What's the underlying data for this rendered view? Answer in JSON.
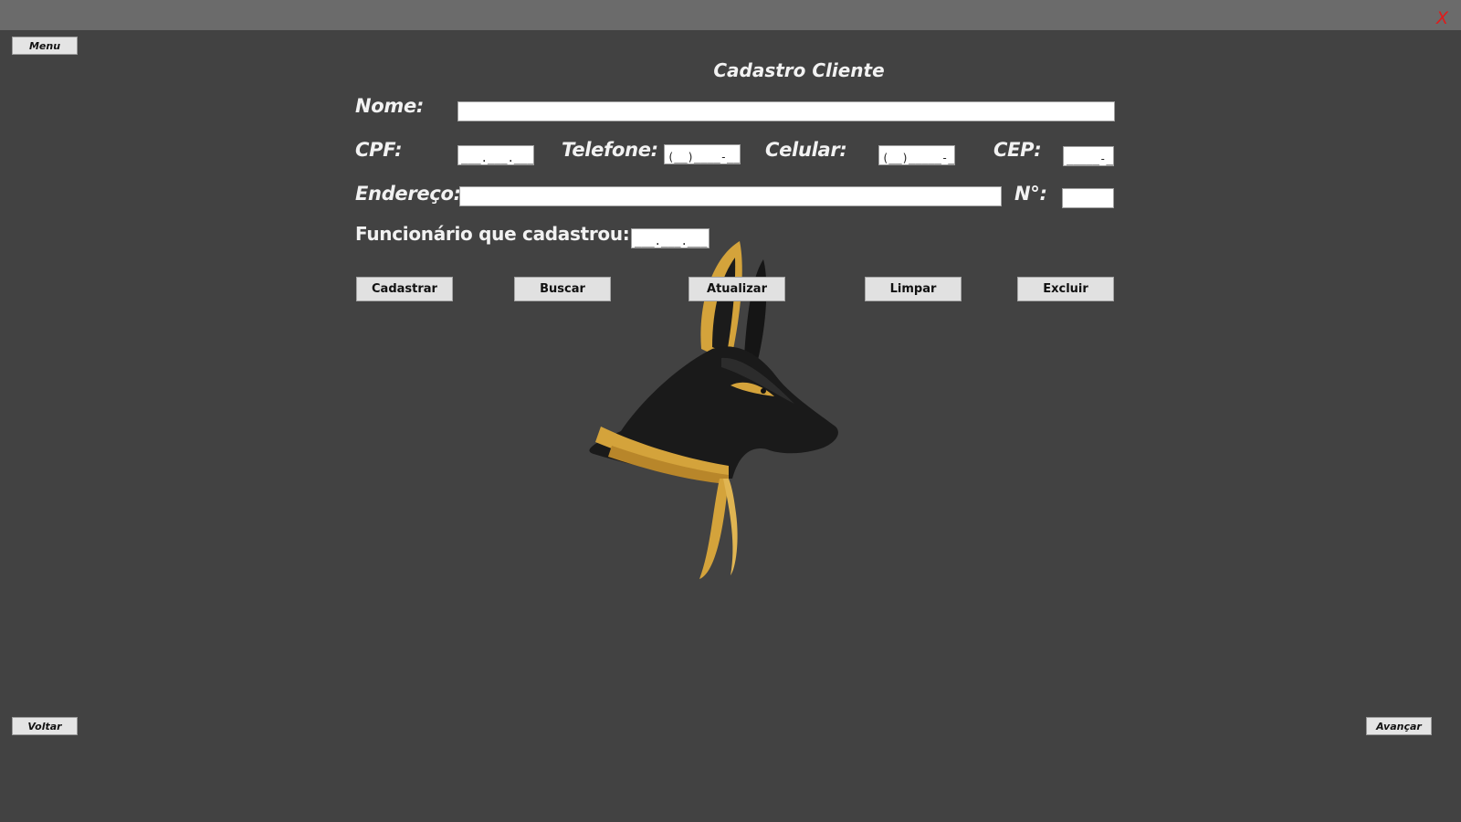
{
  "titlebar": {
    "close_label": "X"
  },
  "nav": {
    "menu_label": "Menu",
    "back_label": "Voltar",
    "next_label": "Avançar"
  },
  "form": {
    "title": "Cadastro Cliente",
    "labels": {
      "nome": "Nome:",
      "cpf": "CPF:",
      "telefone": "Telefone:",
      "celular": "Celular:",
      "cep": "CEP:",
      "endereco": "Endereço:",
      "numero": "N°:",
      "funcionario": "Funcionário que cadastrou:"
    },
    "values": {
      "nome": "",
      "cpf": "___.___.___-__",
      "telefone": "(__)____-____",
      "celular": "(__)_____-____",
      "cep": "_____-___",
      "endereco": "",
      "numero": "",
      "funcionario": "___.___.___-__"
    }
  },
  "actions": {
    "cadastrar": "Cadastrar",
    "buscar": "Buscar",
    "atualizar": "Atualizar",
    "limpar": "Limpar",
    "excluir": "Excluir"
  },
  "logo": {
    "icon": "anubis-head-logo",
    "colors": {
      "head": "#1a1a1a",
      "gold": "#d4a33b"
    }
  },
  "colors": {
    "background": "#424242",
    "titlebar": "#6b6b6b",
    "close": "#e01b1b"
  }
}
